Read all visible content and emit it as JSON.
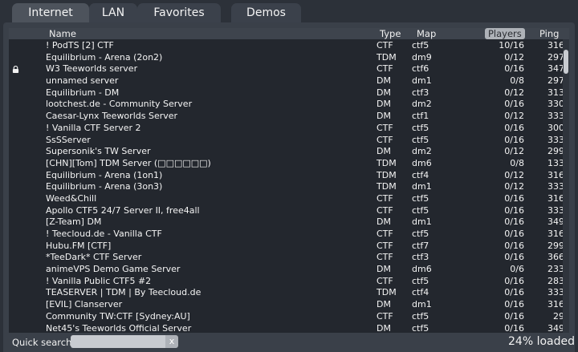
{
  "tabs": [
    "Internet",
    "LAN",
    "Favorites",
    "Demos"
  ],
  "columns": {
    "name": "Name",
    "type": "Type",
    "map": "Map",
    "players": "Players",
    "ping": "Ping"
  },
  "servers": [
    {
      "locked": false,
      "name": "!                                    PodTS [2] CTF",
      "type": "CTF",
      "map": "ctf5",
      "players": "10/16",
      "ping": "316"
    },
    {
      "locked": false,
      "name": "Equilibrium - Arena (2on2)",
      "type": "TDM",
      "map": "dm9",
      "players": "0/12",
      "ping": "297"
    },
    {
      "locked": true,
      "name": "W3 Teeworlds server",
      "type": "CTF",
      "map": "ctf6",
      "players": "0/16",
      "ping": "347"
    },
    {
      "locked": false,
      "name": "unnamed server",
      "type": "DM",
      "map": "dm1",
      "players": "0/8",
      "ping": "297"
    },
    {
      "locked": false,
      "name": "Equilibrium - DM",
      "type": "DM",
      "map": "ctf3",
      "players": "0/12",
      "ping": "313"
    },
    {
      "locked": false,
      "name": "lootchest.de - Community Server",
      "type": "DM",
      "map": "dm2",
      "players": "0/16",
      "ping": "330"
    },
    {
      "locked": false,
      "name": "Caesar-Lynx Teeworlds Server",
      "type": "DM",
      "map": "ctf1",
      "players": "0/12",
      "ping": "333"
    },
    {
      "locked": false,
      "name": "!                     Vanilla CTF Server 2",
      "type": "CTF",
      "map": "ctf5",
      "players": "0/16",
      "ping": "300"
    },
    {
      "locked": false,
      "name": "SsSServer",
      "type": "CTF",
      "map": "ctf5",
      "players": "0/16",
      "ping": "333"
    },
    {
      "locked": false,
      "name": "Supersonik's TW Server",
      "type": "DM",
      "map": "dm2",
      "players": "0/12",
      "ping": "299"
    },
    {
      "locked": false,
      "name": "[CHN][Tom] TDM Server (□□□□□□)",
      "type": "TDM",
      "map": "dm6",
      "players": "0/8",
      "ping": "133"
    },
    {
      "locked": false,
      "name": "Equilibrium - Arena (1on1)",
      "type": "TDM",
      "map": "ctf4",
      "players": "0/12",
      "ping": "316"
    },
    {
      "locked": false,
      "name": "Equilibrium - Arena (3on3)",
      "type": "TDM",
      "map": "dm1",
      "players": "0/12",
      "ping": "333"
    },
    {
      "locked": false,
      "name": "Weed&Chill",
      "type": "CTF",
      "map": "ctf5",
      "players": "0/16",
      "ping": "316"
    },
    {
      "locked": false,
      "name": "Apollo CTF5 24/7 Server II, free4all",
      "type": "CTF",
      "map": "ctf5",
      "players": "0/16",
      "ping": "333"
    },
    {
      "locked": false,
      "name": "[Z-Team] DM",
      "type": "DM",
      "map": "dm1",
      "players": "0/16",
      "ping": "349"
    },
    {
      "locked": false,
      "name": "!     Teecloud.de - Vanilla CTF",
      "type": "CTF",
      "map": "ctf5",
      "players": "0/16",
      "ping": "316"
    },
    {
      "locked": false,
      "name": "Hubu.FM [CTF]",
      "type": "CTF",
      "map": "ctf7",
      "players": "0/16",
      "ping": "299"
    },
    {
      "locked": false,
      "name": "*TeeDark* CTF Server",
      "type": "CTF",
      "map": "ctf3",
      "players": "0/16",
      "ping": "366"
    },
    {
      "locked": false,
      "name": "animeVPS Demo Game Server",
      "type": "DM",
      "map": "dm6",
      "players": "0/6",
      "ping": "233"
    },
    {
      "locked": false,
      "name": "!  Vanilla Public CTF5 #2",
      "type": "CTF",
      "map": "ctf5",
      "players": "0/16",
      "ping": "283"
    },
    {
      "locked": false,
      "name": "TEASERVER | TDM | By Teecloud.de",
      "type": "TDM",
      "map": "ctf4",
      "players": "0/16",
      "ping": "333"
    },
    {
      "locked": false,
      "name": "[EVIL] Clanserver",
      "type": "DM",
      "map": "dm1",
      "players": "0/16",
      "ping": "316"
    },
    {
      "locked": false,
      "name": "Community TW:CTF [Sydney:AU]",
      "type": "CTF",
      "map": "ctf5",
      "players": "0/16",
      "ping": "29"
    },
    {
      "locked": false,
      "name": "Net45's Teeworlds Official Server",
      "type": "DM",
      "map": "ctf5",
      "players": "0/16",
      "ping": "349"
    }
  ],
  "footer": {
    "search_label": "Quick search:",
    "search_value": "",
    "clear_label": "x",
    "loaded_text": "24% loaded"
  }
}
